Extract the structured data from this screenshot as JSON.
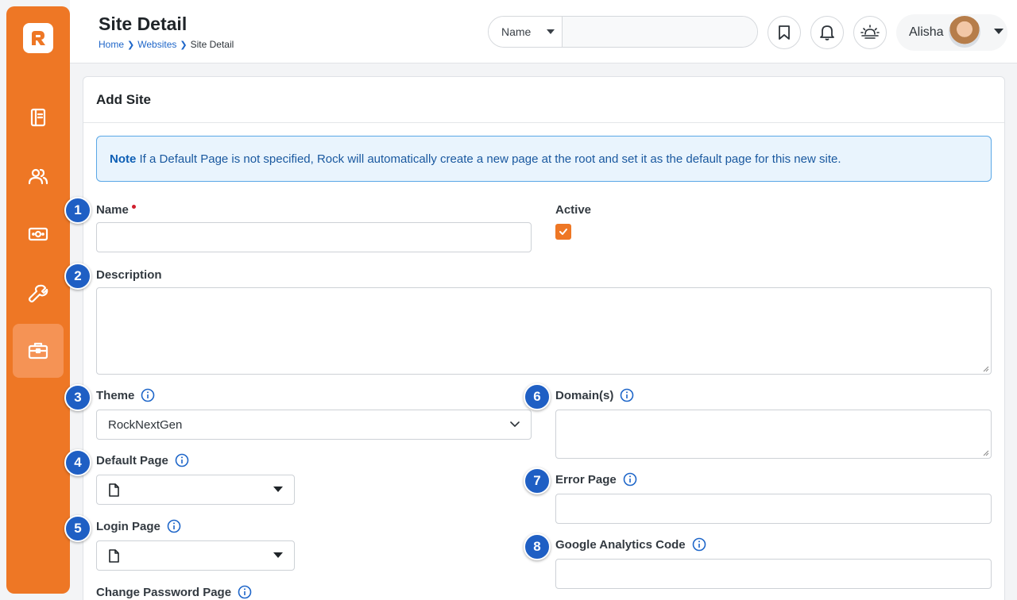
{
  "header": {
    "title": "Site Detail",
    "breadcrumbs": [
      "Home",
      "Websites",
      "Site Detail"
    ],
    "search_filter": "Name",
    "search_value": "",
    "user_name": "Alisha"
  },
  "sidebar": {
    "items": [
      {
        "icon": "notebook-icon"
      },
      {
        "icon": "people-icon"
      },
      {
        "icon": "money-icon"
      },
      {
        "icon": "wrench-icon"
      },
      {
        "icon": "briefcase-icon",
        "active": true
      }
    ]
  },
  "card": {
    "title": "Add Site",
    "note_label": "Note",
    "note_text": " If a Default Page is not specified, Rock will automatically create a new page at the root and set it as the default page for this new site."
  },
  "form": {
    "name_label": "Name",
    "name_value": "",
    "active_label": "Active",
    "active_checked": true,
    "description_label": "Description",
    "description_value": "",
    "theme_label": "Theme",
    "theme_value": "RockNextGen",
    "domains_label": "Domain(s)",
    "default_page_label": "Default Page",
    "error_page_label": "Error Page",
    "login_page_label": "Login Page",
    "ga_label": "Google Analytics Code",
    "change_password_label": "Change Password Page"
  },
  "callouts": [
    "1",
    "2",
    "3",
    "4",
    "5",
    "6",
    "7",
    "8"
  ],
  "colors": {
    "brand": "#ee7725",
    "callout": "#1f5fc4",
    "link": "#1e66c9"
  }
}
